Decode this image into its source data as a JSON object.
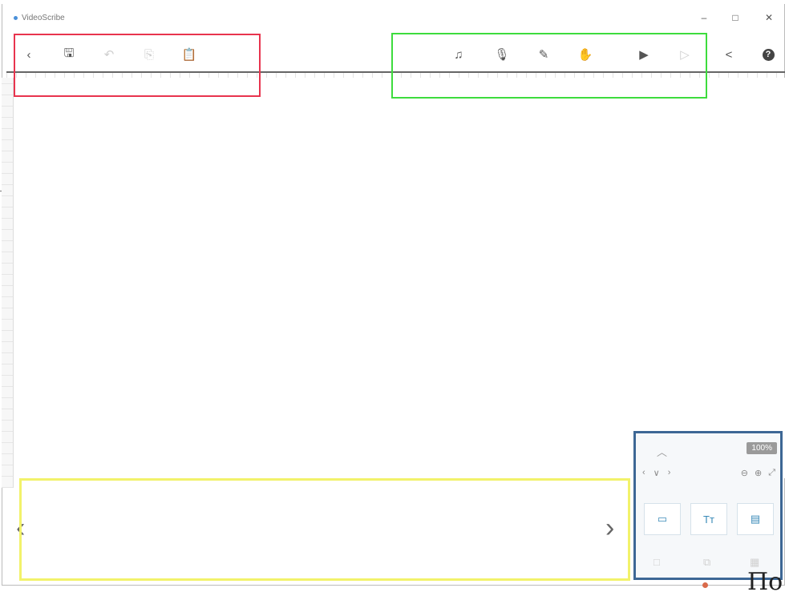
{
  "window": {
    "title": "VideoScribe",
    "minimize": "–",
    "maximize": "□",
    "close": "✕"
  },
  "toolbar": {
    "left": [
      {
        "name": "back",
        "glyph": "‹",
        "enabled": true
      },
      {
        "name": "save",
        "glyph": "🖫",
        "enabled": true
      },
      {
        "name": "undo",
        "glyph": "↶",
        "enabled": false
      },
      {
        "name": "copy",
        "glyph": "⎘",
        "enabled": false
      },
      {
        "name": "paste",
        "glyph": "📋",
        "enabled": false
      }
    ],
    "right": [
      {
        "name": "music",
        "glyph": "♫",
        "enabled": true
      },
      {
        "name": "microphone",
        "glyph": "🎙",
        "enabled": true
      },
      {
        "name": "pen",
        "glyph": "✎",
        "enabled": true
      },
      {
        "name": "hand",
        "glyph": "✋",
        "enabled": true
      },
      {
        "name": "play",
        "glyph": "▶",
        "enabled": true
      },
      {
        "name": "play-from-here",
        "glyph": "▷",
        "enabled": false
      },
      {
        "name": "share",
        "glyph": "<",
        "enabled": true
      },
      {
        "name": "help",
        "glyph": "?",
        "enabled": true
      }
    ]
  },
  "timeline": {
    "prev": "‹",
    "next": "›"
  },
  "panel": {
    "zoom_up": "︿",
    "zoom_badge": "100%",
    "nav": [
      "‹",
      "∨",
      "›"
    ],
    "zoom_tools": [
      "⊖",
      "⊕",
      "⤢"
    ],
    "tiles": [
      "▭",
      "Tт",
      "▤"
    ],
    "bottom_tools": [
      "□",
      "⧉",
      "▦"
    ]
  },
  "caption": {
    "text": "По"
  },
  "colors": {
    "annotation_red": "#e8344e",
    "annotation_green": "#3ddc3d",
    "annotation_yellow": "#f2f26a",
    "annotation_blue": "#3d6795",
    "bullet": "#d96a4a"
  }
}
